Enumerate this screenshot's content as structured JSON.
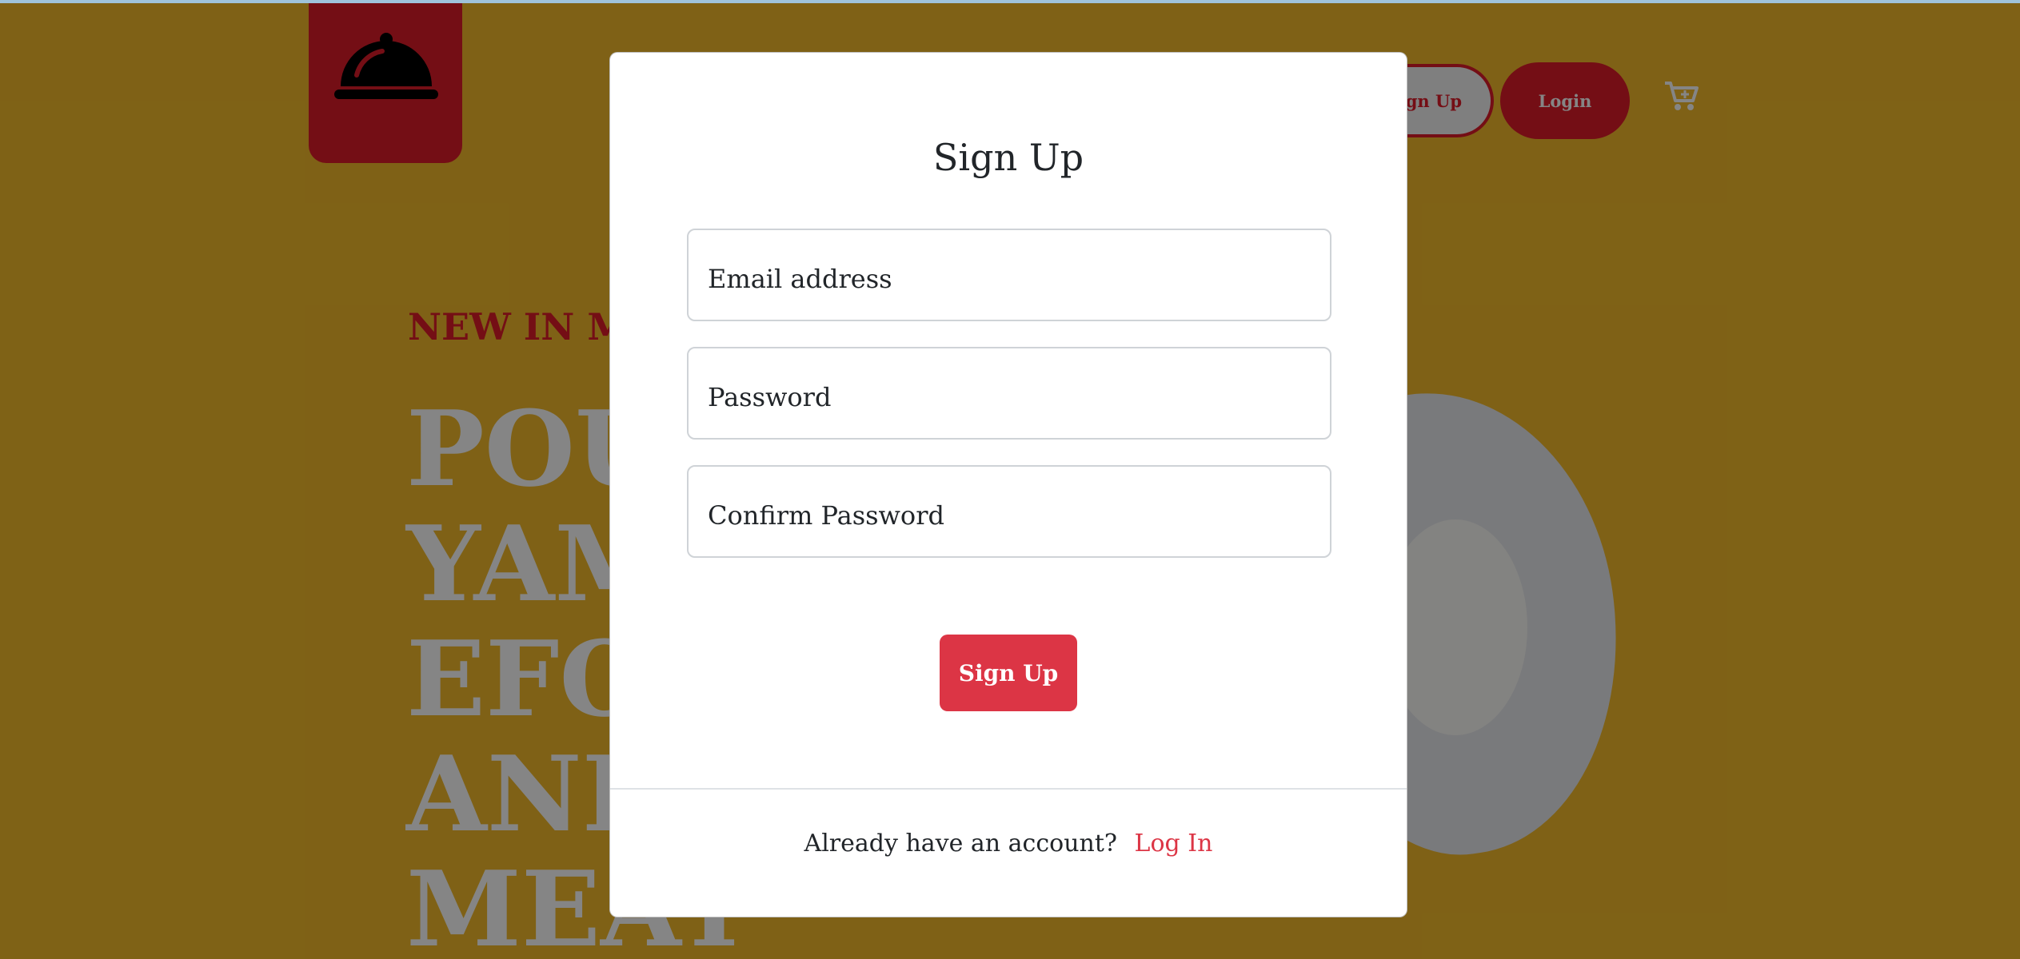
{
  "nav": {
    "signup_label": "Sign Up",
    "login_label": "Login"
  },
  "hero": {
    "kicker": "NEW IN MENU",
    "title_lines": [
      "POUNDED",
      "YAM WITH",
      "EFO RIRO",
      "AND",
      "MEAT"
    ]
  },
  "modal": {
    "title": "Sign Up",
    "email_placeholder": "Email address",
    "password_placeholder": "Password",
    "confirm_placeholder": "Confirm Password",
    "submit_label": "Sign Up",
    "footer_text": "Already have an account?",
    "footer_link": "Log In"
  },
  "colors": {
    "background": "#f4bb2b",
    "brand_red": "#de1c2a",
    "button_red": "#dc3545",
    "overlay": "rgba(0,0,0,0.48)"
  },
  "icons": [
    "cloche-icon",
    "cart-plus-icon"
  ]
}
